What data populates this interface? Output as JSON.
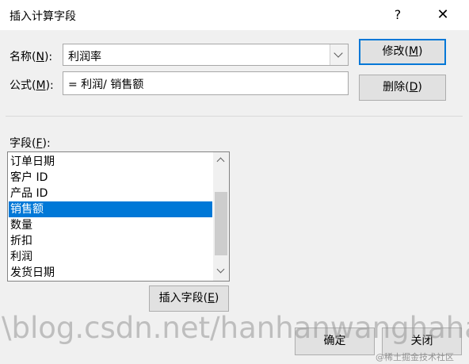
{
  "window": {
    "title": "插入计算字段",
    "help": "?",
    "close": "✕"
  },
  "name": {
    "label": "名称",
    "accel": "N",
    "value": "利润率"
  },
  "formula": {
    "label": "公式",
    "accel": "M",
    "value": "= 利润/ 销售额"
  },
  "buttons": {
    "modify": {
      "label": "修改",
      "accel": "M"
    },
    "delete": {
      "label": "删除",
      "accel": "D"
    },
    "insert_field": {
      "label": "插入字段",
      "accel": "E"
    },
    "ok": {
      "label": "确定"
    },
    "cancel": {
      "label": "关闭"
    }
  },
  "fields": {
    "label": "字段",
    "accel": "F",
    "items": [
      "订单日期",
      "客户 ID",
      "产品 ID",
      "销售额",
      "数量",
      "折扣",
      "利润",
      "发货日期"
    ],
    "selected": "销售额"
  },
  "watermark": {
    "text": "\\blog.csdn.net/hanhanwanghaha",
    "source": "@稀土掘金技术社区"
  }
}
